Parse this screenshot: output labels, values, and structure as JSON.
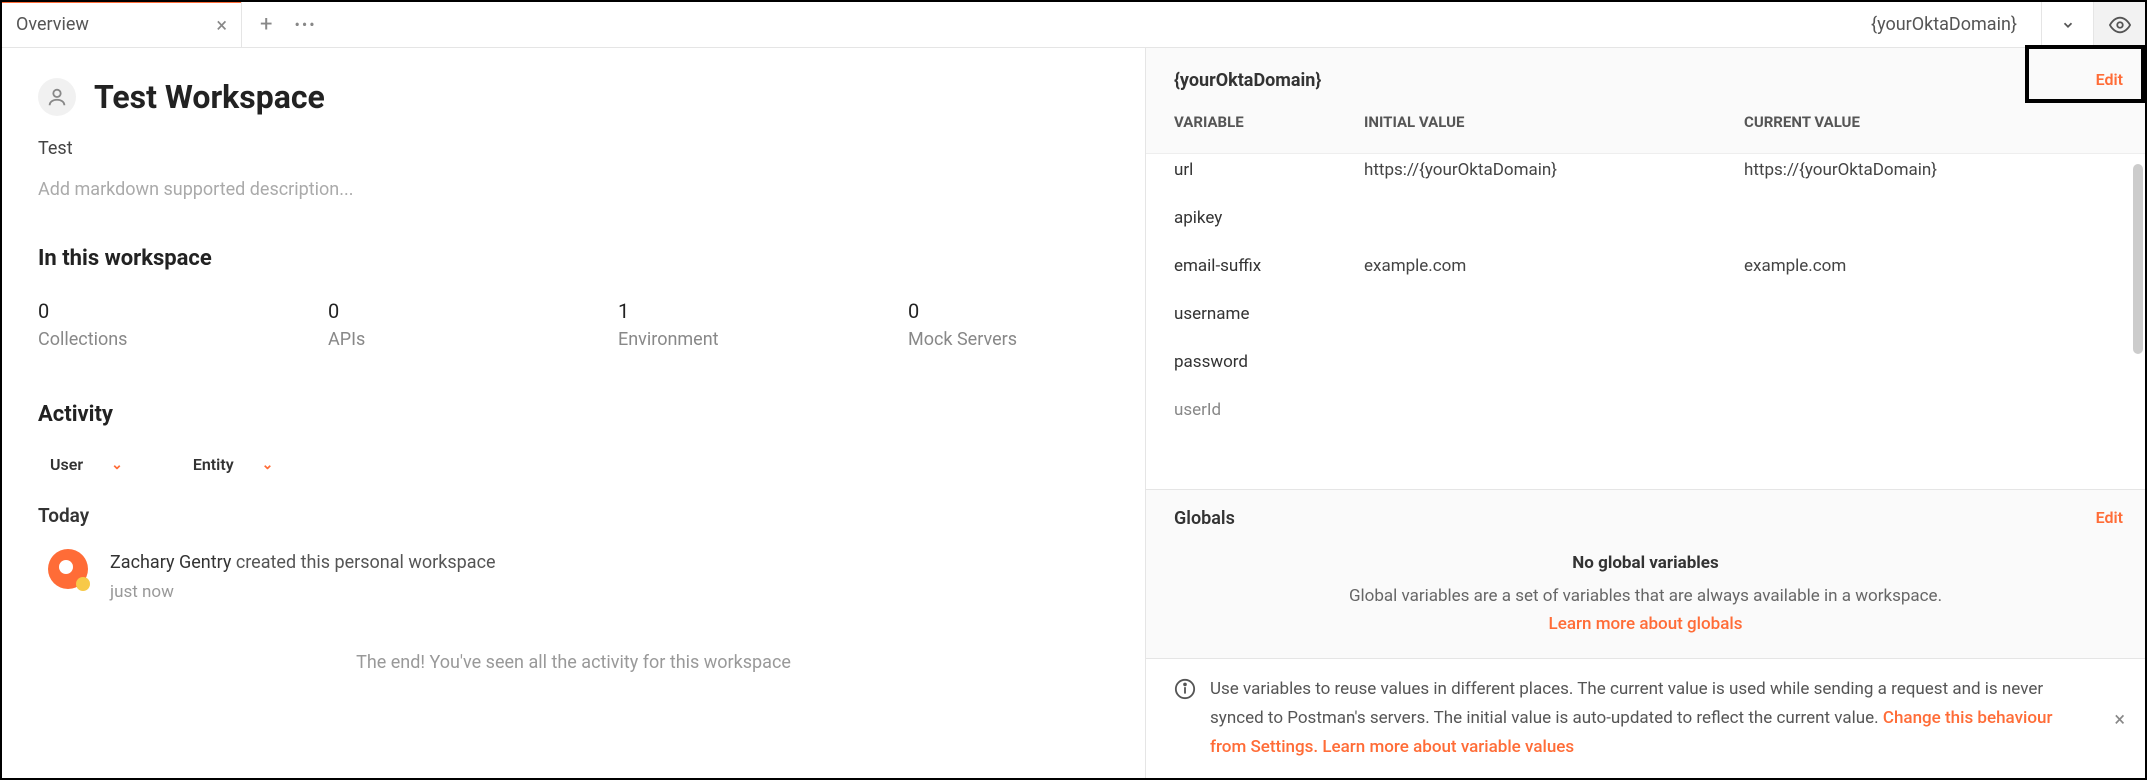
{
  "tabs": {
    "active": {
      "label": "Overview"
    }
  },
  "env": {
    "selected": "{yourOktaDomain}"
  },
  "workspace": {
    "title": "Test Workspace",
    "subtitle": "Test",
    "description_placeholder": "Add markdown supported description...",
    "section_heading": "In this workspace",
    "stats": [
      {
        "value": "0",
        "label": "Collections"
      },
      {
        "value": "0",
        "label": "APIs"
      },
      {
        "value": "1",
        "label": "Environment"
      },
      {
        "value": "0",
        "label": "Mock Servers"
      }
    ],
    "activity": {
      "heading": "Activity",
      "filters": [
        {
          "label": "User"
        },
        {
          "label": "Entity"
        }
      ],
      "group": "Today",
      "items": [
        {
          "user": "Zachary Gentry",
          "text": " created this personal workspace",
          "time": "just now"
        }
      ],
      "end_text": "The end! You've seen all the activity for this workspace"
    }
  },
  "panel": {
    "env_name": "{yourOktaDomain}",
    "edit_label": "Edit",
    "columns": {
      "variable": "VARIABLE",
      "initial": "INITIAL VALUE",
      "current": "CURRENT VALUE"
    },
    "variables": [
      {
        "name": "url",
        "initial": "https://{yourOktaDomain}",
        "current": "https://{yourOktaDomain}"
      },
      {
        "name": "apikey",
        "initial": "",
        "current": ""
      },
      {
        "name": "email-suffix",
        "initial": "example.com",
        "current": "example.com"
      },
      {
        "name": "username",
        "initial": "",
        "current": ""
      },
      {
        "name": "password",
        "initial": "",
        "current": ""
      },
      {
        "name": "userId",
        "initial": "",
        "current": "",
        "dim": true
      }
    ],
    "globals": {
      "title": "Globals",
      "edit_label": "Edit",
      "empty_heading": "No global variables",
      "empty_text": "Global variables are a set of variables that are always available in a workspace.",
      "learn_link": "Learn more about globals"
    },
    "info": {
      "text_1": "Use variables to reuse values in different places. The current value is used while sending a request and is never synced to Postman's servers. The initial value is auto-updated to reflect the current value. ",
      "link_1": "Change this behaviour from Settings.",
      "link_2": "Learn more about variable values"
    }
  }
}
